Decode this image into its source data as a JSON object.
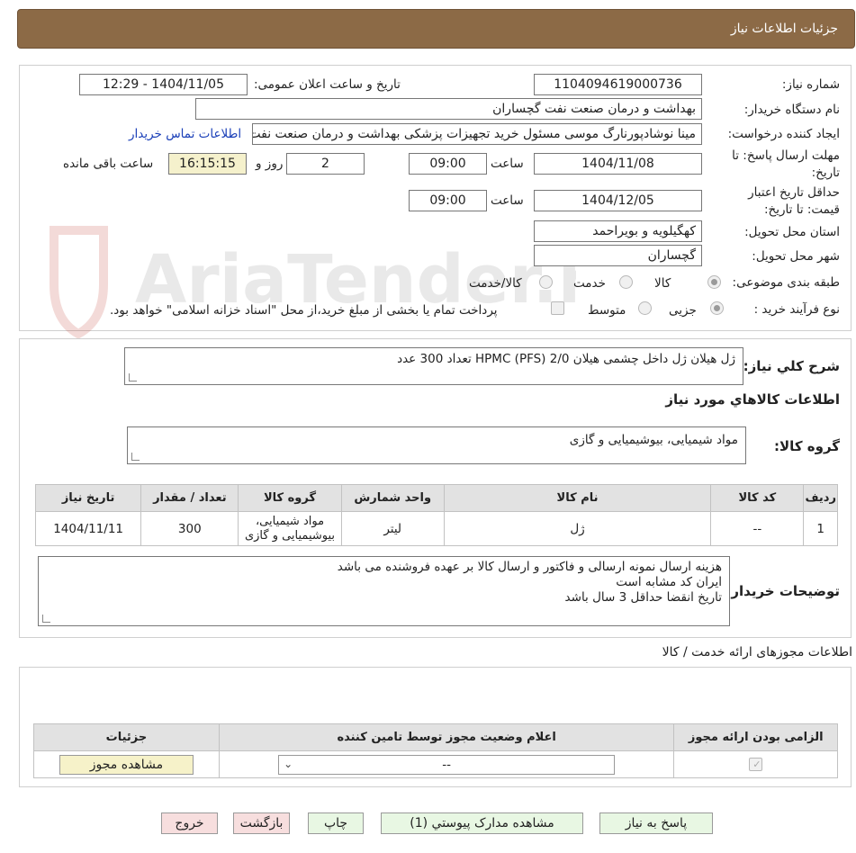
{
  "header": {
    "title": "جزئیات اطلاعات نیاز"
  },
  "form": {
    "need_number_label": "شماره نیاز:",
    "need_number": "1104094619000736",
    "announce_label": "تاریخ و ساعت اعلان عمومی:",
    "announce_value": "1404/11/05 - 12:29",
    "buyer_org_label": "نام دستگاه خریدار:",
    "buyer_org": "بهداشت و درمان صنعت نفت گچساران",
    "requester_label": "ایجاد کننده درخواست:",
    "requester": "مینا نوشادپورنارگ موسی مسئول خرید تجهیزات پزشکی  بهداشت و درمان صنعت نفت گچساران",
    "contact_link": "اطلاعات تماس خریدار",
    "deadline_label": "مهلت ارسال پاسخ: تا تاریخ:",
    "deadline_date": "1404/11/08",
    "time_label": "ساعت",
    "deadline_time": "09:00",
    "days_value": "2",
    "days_label": "روز و",
    "remaining_time": "16:15:15",
    "remaining_label": "ساعت باقی مانده",
    "validity_label": "حداقل تاریخ اعتبار قیمت: تا تاریخ:",
    "validity_date": "1404/12/05",
    "validity_time": "09:00",
    "province_label": "استان محل تحویل:",
    "province": "کهگیلویه و بویراحمد",
    "city_label": "شهر محل تحویل:",
    "city": "گچساران",
    "category_label": "طبقه بندی موضوعی:",
    "category_options": [
      "کالا",
      "خدمت",
      "کالا/خدمت"
    ],
    "process_label": "نوع فرآیند خرید :",
    "process_options": [
      "جزیی",
      "متوسط"
    ],
    "payment_note": "پرداخت تمام یا بخشی از مبلغ خرید،از محل \"اسناد خزانه اسلامی\" خواهد بود."
  },
  "description": {
    "label": "شرح کلي نياز:",
    "text": "ژل هیلان ژل داخل چشمی هیلان 2/0      HPMC   (PFS) تعداد 300 عدد"
  },
  "goods_info": {
    "title": "اطلاعات کالاهاي مورد نياز",
    "group_label": "گروه کالا:",
    "group_value": "مواد شیمیایی، بیوشیمیایی و  گازی",
    "columns": [
      "رديف",
      "کد کالا",
      "نام کالا",
      "واحد شمارش",
      "گروه کالا",
      "تعداد / مقدار",
      "تاريخ نياز"
    ],
    "rows": [
      [
        "1",
        "--",
        "ژل",
        "لیتر",
        "مواد شیمیایی، بیوشیمیایی و گازی",
        "300",
        "1404/11/11"
      ]
    ]
  },
  "buyer_notes": {
    "label": "توضیحات خریدار:",
    "lines": [
      "هزینه ارسال نمونه ارسالی و فاکتور و ارسال کالا بر عهده فروشنده می باشد",
      "ایران کد مشابه است",
      "تاریخ انقضا حداقل 3 سال باشد"
    ]
  },
  "permits": {
    "title": "اطلاعات مجوزهای ارائه خدمت / کالا",
    "columns": [
      "الزامی بودن ارائه مجوز",
      "اعلام وضعیت مجوز توسط تامین کننده",
      "جزئیات"
    ],
    "select_value": "--",
    "view_button": "مشاهده مجوز"
  },
  "buttons": {
    "reply": "پاسخ به نیاز",
    "attachments": "مشاهده مدارک پیوستي (1)",
    "print": "چاپ",
    "back": "بازگشت",
    "exit": "خروج"
  },
  "watermark": {
    "text": "AriaTender.neT"
  }
}
